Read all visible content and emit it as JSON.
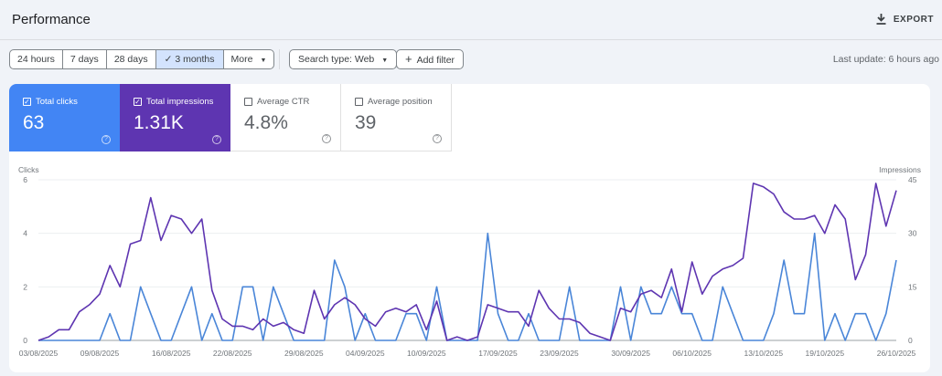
{
  "header": {
    "title": "Performance",
    "export_label": "EXPORT",
    "export_icon": "download-icon"
  },
  "filters": {
    "ranges": [
      {
        "label": "24 hours"
      },
      {
        "label": "7 days"
      },
      {
        "label": "28 days"
      },
      {
        "label": "3 months",
        "selected": true
      },
      {
        "label": "More"
      }
    ],
    "search_type": "Search type: Web",
    "add_filter": "Add filter",
    "last_update": "Last update: 6 hours ago"
  },
  "metrics": [
    {
      "label": "Total clicks",
      "value": "63",
      "checked": true,
      "color": "#4285f4"
    },
    {
      "label": "Total impressions",
      "value": "1.31K",
      "checked": true,
      "color": "#5e35b1"
    },
    {
      "label": "Average CTR",
      "value": "4.8%",
      "checked": false
    },
    {
      "label": "Average position",
      "value": "39",
      "checked": false
    }
  ],
  "chart_data": {
    "type": "line",
    "left_axis": {
      "label": "Clicks",
      "ticks": [
        "0",
        "2",
        "4",
        "6"
      ],
      "range": [
        0,
        6
      ]
    },
    "right_axis": {
      "label": "Impressions",
      "ticks": [
        "0",
        "15",
        "30",
        "45"
      ],
      "range": [
        0,
        45
      ]
    },
    "x_tick_labels": [
      "03/08/2025",
      "09/08/2025",
      "16/08/2025",
      "22/08/2025",
      "29/08/2025",
      "04/09/2025",
      "10/09/2025",
      "17/09/2025",
      "23/09/2025",
      "30/09/2025",
      "06/10/2025",
      "13/10/2025",
      "19/10/2025",
      "26/10/2025"
    ],
    "x_range": [
      "03/08/2025",
      "26/10/2025"
    ],
    "grid": true,
    "series": [
      {
        "name": "Clicks",
        "axis": "left",
        "color": "#4a86d8",
        "values": [
          0,
          0,
          0,
          0,
          0,
          0,
          0,
          1,
          0,
          0,
          2,
          1,
          0,
          0,
          1,
          2,
          0,
          1,
          0,
          0,
          2,
          2,
          0,
          2,
          1,
          0,
          0,
          0,
          0,
          3,
          2,
          0,
          1,
          0,
          0,
          0,
          1,
          1,
          0,
          2,
          0,
          0,
          0,
          0,
          4,
          1,
          0,
          0,
          1,
          0,
          0,
          0,
          2,
          0,
          0,
          0,
          0,
          2,
          0,
          2,
          1,
          1,
          2,
          1,
          1,
          0,
          0,
          2,
          1,
          0,
          0,
          0,
          1,
          3,
          1,
          1,
          4,
          0,
          1,
          0,
          1,
          1,
          0,
          1,
          3
        ]
      },
      {
        "name": "Impressions",
        "axis": "right",
        "color": "#5e35b1",
        "values": [
          0,
          1,
          3,
          3,
          8,
          10,
          13,
          21,
          15,
          27,
          28,
          40,
          28,
          35,
          34,
          30,
          34,
          14,
          6,
          4,
          4,
          3,
          6,
          4,
          5,
          3,
          2,
          14,
          6,
          10,
          12,
          10,
          6,
          4,
          8,
          9,
          8,
          10,
          3,
          11,
          0,
          1,
          0,
          1,
          10,
          9,
          8,
          8,
          4,
          14,
          9,
          6,
          6,
          5,
          2,
          1,
          0,
          9,
          8,
          13,
          14,
          12,
          20,
          8,
          22,
          13,
          18,
          20,
          21,
          23,
          44,
          43,
          41,
          36,
          34,
          34,
          35,
          30,
          38,
          34,
          17,
          24,
          44,
          32,
          42
        ]
      }
    ]
  }
}
